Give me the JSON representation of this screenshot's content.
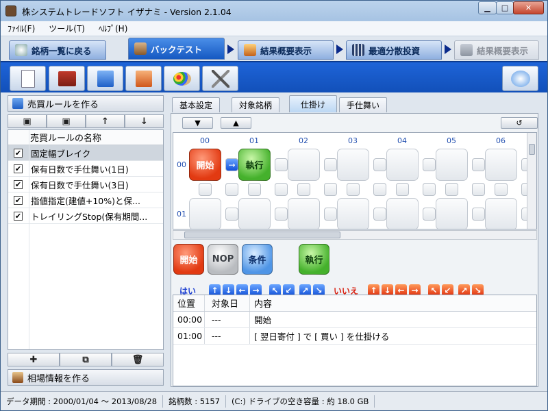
{
  "window": {
    "title": "株システムトレードソフト イザナミ - Version 2.1.04",
    "min_glyph": "▁",
    "max_glyph": "□",
    "close_glyph": "✕"
  },
  "menu": [
    "ﾌｧｲﾙ(F)",
    "ツール(T)",
    "ﾍﾙﾌﾟ(H)"
  ],
  "main_tabs": [
    {
      "label": "銘柄一覧に戻る",
      "state": "normal"
    },
    {
      "label": "バックテスト",
      "state": "active"
    },
    {
      "label": "結果概要表示",
      "state": "normal"
    },
    {
      "label": "最適分散投資",
      "state": "normal"
    },
    {
      "label": "結果概要表示",
      "state": "disabled"
    }
  ],
  "toolbar_icons": [
    "new-document-icon",
    "open-icon",
    "export-icon",
    "import-icon",
    "palette-icon",
    "tools-icon",
    "settings-icon"
  ],
  "left": {
    "rules_header": "売買ルールを作る",
    "rule_list_header": "売買ルールの名称",
    "rules": [
      {
        "checked": true,
        "name": "固定幅ブレイク"
      },
      {
        "checked": true,
        "name": "保有日数で手仕舞い(1日)"
      },
      {
        "checked": true,
        "name": "保有日数で手仕舞い(3日)"
      },
      {
        "checked": true,
        "name": "指値指定(建値+10%)と保..."
      },
      {
        "checked": true,
        "name": "トレイリングStop(保有期間..."
      }
    ],
    "check_glyph": "✔",
    "bottom_buttons": [
      "✚",
      "⧉",
      "🗑"
    ],
    "market_header": "相場情報を作る"
  },
  "right": {
    "subtabs": [
      "基本設定",
      "対象銘柄",
      "仕掛け",
      "手仕舞い"
    ],
    "active_subtab": 2,
    "grid": {
      "col_labels": [
        "00",
        "01",
        "02",
        "03",
        "04",
        "05",
        "06"
      ],
      "row_labels": [
        "00",
        "01"
      ],
      "start_node": "開始",
      "exec_node": "執行"
    },
    "palette": {
      "nodes": [
        "開始",
        "NOP",
        "条件",
        "執行"
      ],
      "yes_label": "はい",
      "no_label": "いいえ",
      "arrow_glyphs": [
        "↑",
        "↓",
        "←",
        "→",
        "↖",
        "↙",
        "↗",
        "↘"
      ]
    },
    "log": {
      "headers": [
        "位置",
        "対象日",
        "内容"
      ],
      "rows": [
        {
          "pos": "00:00",
          "date": "---",
          "content": "開始"
        },
        {
          "pos": "01:00",
          "date": "---",
          "content": "[ 翌日寄付 ] で [ 買い ] を仕掛ける"
        }
      ]
    }
  },
  "status": {
    "period": "データ期間 : 2000/01/04 〜 2013/08/28",
    "count": "銘柄数 : 5157",
    "disk": "(C:) ドライブの空き容量 : 約 18.0 GB"
  },
  "colors": {
    "toolbar_blue": "#1659c2",
    "start_red": "#e23a12",
    "exec_green": "#45b12c",
    "yes_blue": "#1250d8",
    "no_red": "#e0300e"
  }
}
